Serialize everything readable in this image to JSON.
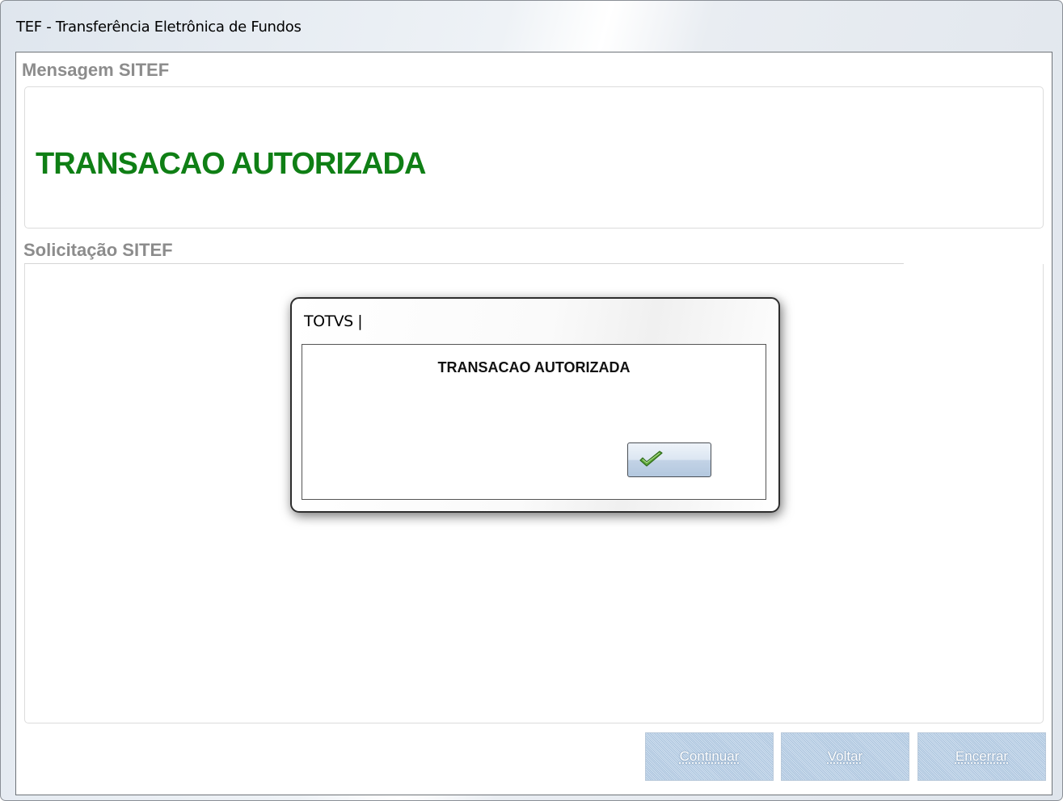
{
  "window": {
    "title": "TEF - Transferência Eletrônica de Fundos"
  },
  "mensagem": {
    "label": "Mensagem SITEF",
    "text": "TRANSACAO AUTORIZADA",
    "text_color": "#0f7f15"
  },
  "solicitacao": {
    "label": "Solicitação SITEF"
  },
  "buttons": {
    "continuar": "Continuar",
    "voltar": "Voltar",
    "encerrar": "Encerrar"
  },
  "dialog": {
    "title": "TOTVS |",
    "message": "TRANSACAO AUTORIZADA",
    "ok_icon": "checkmark-icon"
  }
}
